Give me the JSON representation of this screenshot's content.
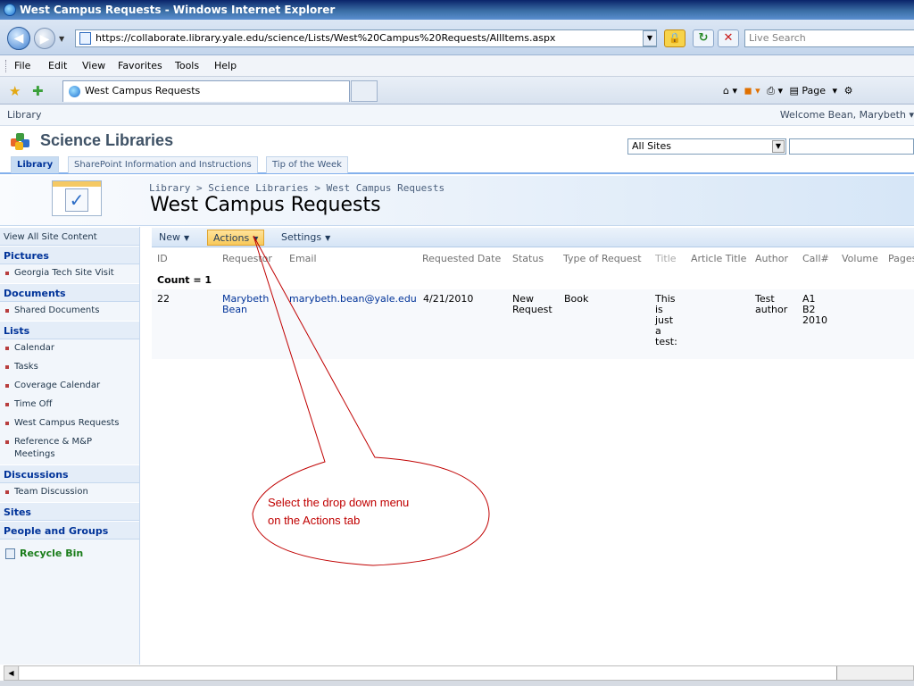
{
  "window": {
    "title": "West Campus Requests - Windows Internet Explorer"
  },
  "address": {
    "url": "https://collaborate.library.yale.edu/science/Lists/West%20Campus%20Requests/AllItems.aspx",
    "search_placeholder": "Live Search"
  },
  "menubar": [
    "File",
    "Edit",
    "View",
    "Favorites",
    "Tools",
    "Help"
  ],
  "tab": {
    "title": "West Campus Requests"
  },
  "commandbar": {
    "page_label": "Page"
  },
  "sharepoint": {
    "top_left": "Library",
    "welcome": "Welcome Bean, Marybeth",
    "site_title": "Science Libraries",
    "scope": "All Sites",
    "tabs": [
      "Library",
      "SharePoint Information and Instructions",
      "Tip of the Week"
    ],
    "breadcrumb": "Library > Science Libraries > West Campus Requests",
    "page_title": "West Campus Requests"
  },
  "leftnav": {
    "view_all": "View All Site Content",
    "pictures": {
      "head": "Pictures",
      "items": [
        "Georgia Tech Site Visit"
      ]
    },
    "documents": {
      "head": "Documents",
      "items": [
        "Shared Documents"
      ]
    },
    "lists": {
      "head": "Lists",
      "items": [
        "Calendar",
        "Tasks",
        "Coverage Calendar",
        "Time Off",
        "West Campus Requests",
        "Reference & M&P Meetings"
      ]
    },
    "discussions": {
      "head": "Discussions",
      "items": [
        "Team Discussion"
      ]
    },
    "sites": "Sites",
    "people": "People and Groups",
    "recycle": "Recycle Bin"
  },
  "toolbar": {
    "new": "New",
    "actions": "Actions",
    "settings": "Settings"
  },
  "table": {
    "columns": [
      "ID",
      "Requestor",
      "Email",
      "Requested Date",
      "Status",
      "Type of Request",
      "Title",
      "Article Title",
      "Author",
      "Call#",
      "Volume",
      "Pages"
    ],
    "count": "Count = 1",
    "row": {
      "id": "22",
      "requestor_1": "Marybeth",
      "requestor_2": "Bean",
      "email": "marybeth.bean@yale.edu",
      "date": "4/21/2010",
      "status_1": "New",
      "status_2": "Request",
      "type": "Book",
      "title_1": "This",
      "title_2": "is",
      "title_3": "just",
      "title_4": "a",
      "title_5": "test:",
      "author_1": "Test",
      "author_2": "author",
      "call_1": "A1",
      "call_2": "B2",
      "call_3": "2010"
    }
  },
  "callout": {
    "line1": "Select the drop down menu",
    "line2": "on the Actions tab",
    "color": "#c00000"
  }
}
